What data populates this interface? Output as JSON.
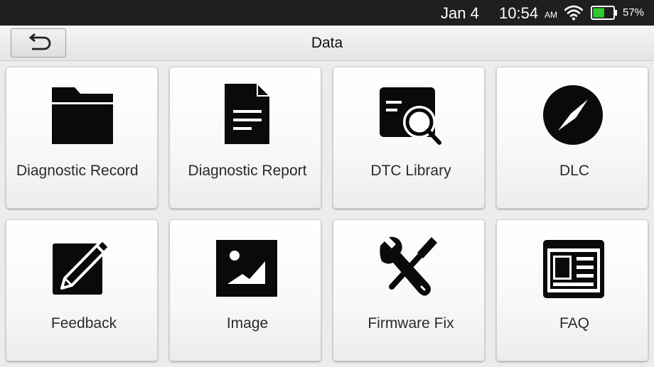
{
  "status_bar": {
    "date": "Jan 4",
    "time": "10:54",
    "ampm": "AM",
    "battery_percent": "57%",
    "battery_level": 0.57,
    "wifi_icon": "wifi-icon",
    "battery_icon": "battery-icon"
  },
  "header": {
    "title": "Data",
    "back_icon": "back-arrow-icon"
  },
  "tiles": [
    {
      "label": "Diagnostic Record",
      "icon": "folder-icon"
    },
    {
      "label": "Diagnostic Report",
      "icon": "document-icon"
    },
    {
      "label": "DTC Library",
      "icon": "library-search-icon"
    },
    {
      "label": "DLC",
      "icon": "compass-icon"
    },
    {
      "label": "Feedback",
      "icon": "edit-pencil-icon"
    },
    {
      "label": "Image",
      "icon": "image-icon"
    },
    {
      "label": "Firmware Fix",
      "icon": "tools-icon"
    },
    {
      "label": "FAQ",
      "icon": "faq-list-icon"
    }
  ],
  "colors": {
    "status_bar_bg": "#1f1f1f",
    "battery_green": "#2ecc2e",
    "icon_color": "#0a0a0a",
    "page_bg": "#ececec"
  }
}
